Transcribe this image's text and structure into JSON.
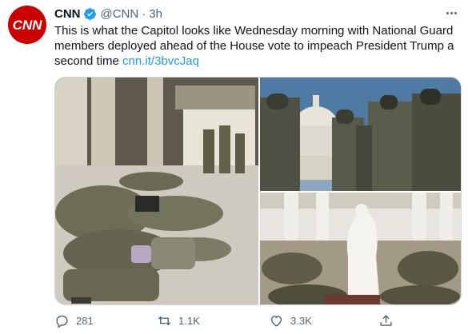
{
  "account": {
    "name": "CNN",
    "handle": "@CNN",
    "separator": "·",
    "time": "3h",
    "avatar_text": "CNN"
  },
  "tweet": {
    "text": "This is what the Capitol looks like Wednesday morning with National Guard members deployed ahead of the House vote to impeach President Trump a second time",
    "link": "cnn.it/3bvcJaq"
  },
  "stats": {
    "replies": "281",
    "retweets": "1.1K",
    "likes": "3.3K"
  },
  "colors": {
    "brand": "#cc0000",
    "link": "#1d9bf0",
    "verified": "#1d9bf0",
    "muted": "#536471"
  }
}
